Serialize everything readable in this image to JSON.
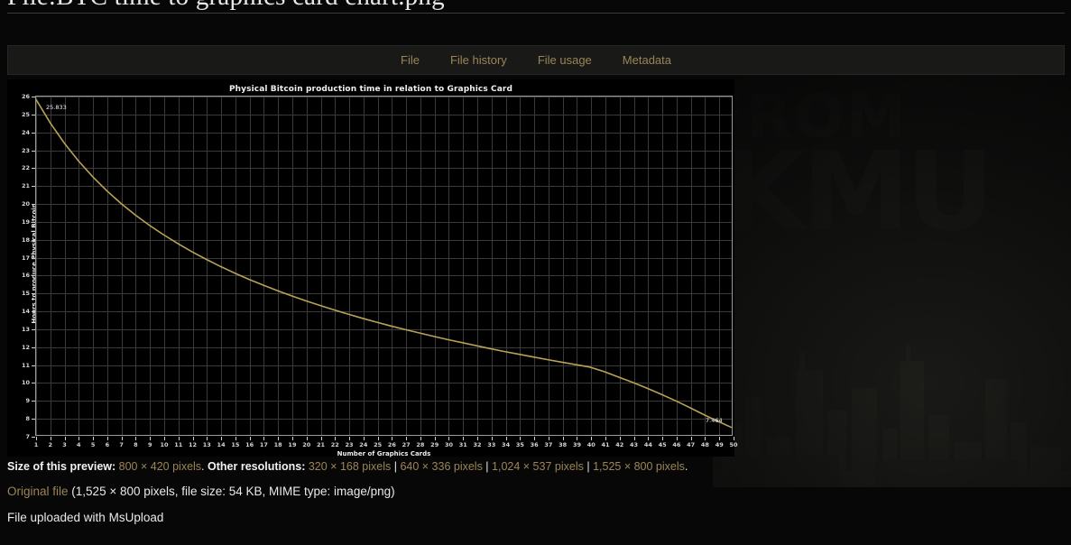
{
  "header": {
    "title": "File:BTC time to graphics card chart.png"
  },
  "tabs": [
    {
      "label": "File"
    },
    {
      "label": "File history"
    },
    {
      "label": "File usage"
    },
    {
      "label": "Metadata"
    }
  ],
  "file_info": {
    "size_label": "Size of this preview:",
    "preview_size": "800 × 420 pixels",
    "size_period": ".",
    "other_label": "Other resolutions:",
    "resolutions": [
      "320 × 168 pixels",
      "640 × 336 pixels",
      "1,024 × 537 pixels",
      "1,525 × 800 pixels"
    ],
    "trailing_period": ".",
    "original_link": "Original file",
    "original_details": "(1,525 × 800 pixels, file size: 54 KB, MIME type: image/png)",
    "upload_note": "File uploaded with MsUpload"
  },
  "skin": {
    "art_word": "FROM",
    "art_word2": "KMU"
  },
  "colors": {
    "accent_link": "#9a8557",
    "curve": "#b8a355",
    "page_bg": "#070707",
    "tab_bg": "#191918",
    "text": "#e9e9e9"
  },
  "chart_data": {
    "type": "line",
    "title": "Physical Bitcoin production time in relation to Graphics Card",
    "xlabel": "Number of Graphics Cards",
    "ylabel": "Hours to produce Physical Bitcoin",
    "xlim": [
      1,
      50
    ],
    "ylim": [
      7,
      26
    ],
    "grid": true,
    "legend": "none",
    "yticks": [
      7,
      8,
      9,
      10,
      11,
      12,
      13,
      14,
      15,
      16,
      17,
      18,
      19,
      20,
      21,
      22,
      23,
      24,
      25,
      26
    ],
    "xticks": [
      1,
      2,
      3,
      4,
      5,
      6,
      7,
      8,
      9,
      10,
      11,
      12,
      13,
      14,
      15,
      16,
      17,
      18,
      19,
      20,
      21,
      22,
      23,
      24,
      25,
      26,
      27,
      28,
      29,
      30,
      31,
      32,
      33,
      34,
      35,
      36,
      37,
      38,
      39,
      40,
      41,
      42,
      43,
      44,
      45,
      46,
      47,
      48,
      49,
      50
    ],
    "annotations": [
      {
        "x": 1,
        "y": 25.833,
        "text": "25.833"
      },
      {
        "x": 50,
        "y": 7.464,
        "text": "7.464"
      }
    ],
    "series": [
      {
        "name": "Hours to produce Physical Bitcoin",
        "color": "#b8a355",
        "x": [
          1,
          2,
          3,
          4,
          5,
          6,
          7,
          8,
          9,
          10,
          11,
          12,
          13,
          14,
          15,
          16,
          17,
          18,
          19,
          20,
          21,
          22,
          23,
          24,
          25,
          26,
          27,
          28,
          29,
          30,
          31,
          32,
          33,
          34,
          35,
          36,
          37,
          38,
          39,
          40,
          41,
          42,
          43,
          44,
          45,
          46,
          47,
          48,
          49,
          50
        ],
        "values": [
          25.833,
          24.52,
          23.38,
          22.38,
          21.5,
          20.71,
          20.0,
          19.36,
          18.78,
          18.25,
          17.76,
          17.3,
          16.88,
          16.48,
          16.11,
          15.76,
          15.44,
          15.13,
          14.84,
          14.56,
          14.3,
          14.05,
          13.81,
          13.58,
          13.36,
          13.15,
          12.95,
          12.76,
          12.57,
          12.39,
          12.22,
          12.05,
          11.88,
          11.72,
          11.57,
          11.42,
          11.27,
          11.13,
          10.99,
          10.85,
          10.6,
          10.3,
          10.0,
          9.68,
          9.34,
          8.98,
          8.6,
          8.2,
          7.82,
          7.464
        ]
      }
    ]
  }
}
